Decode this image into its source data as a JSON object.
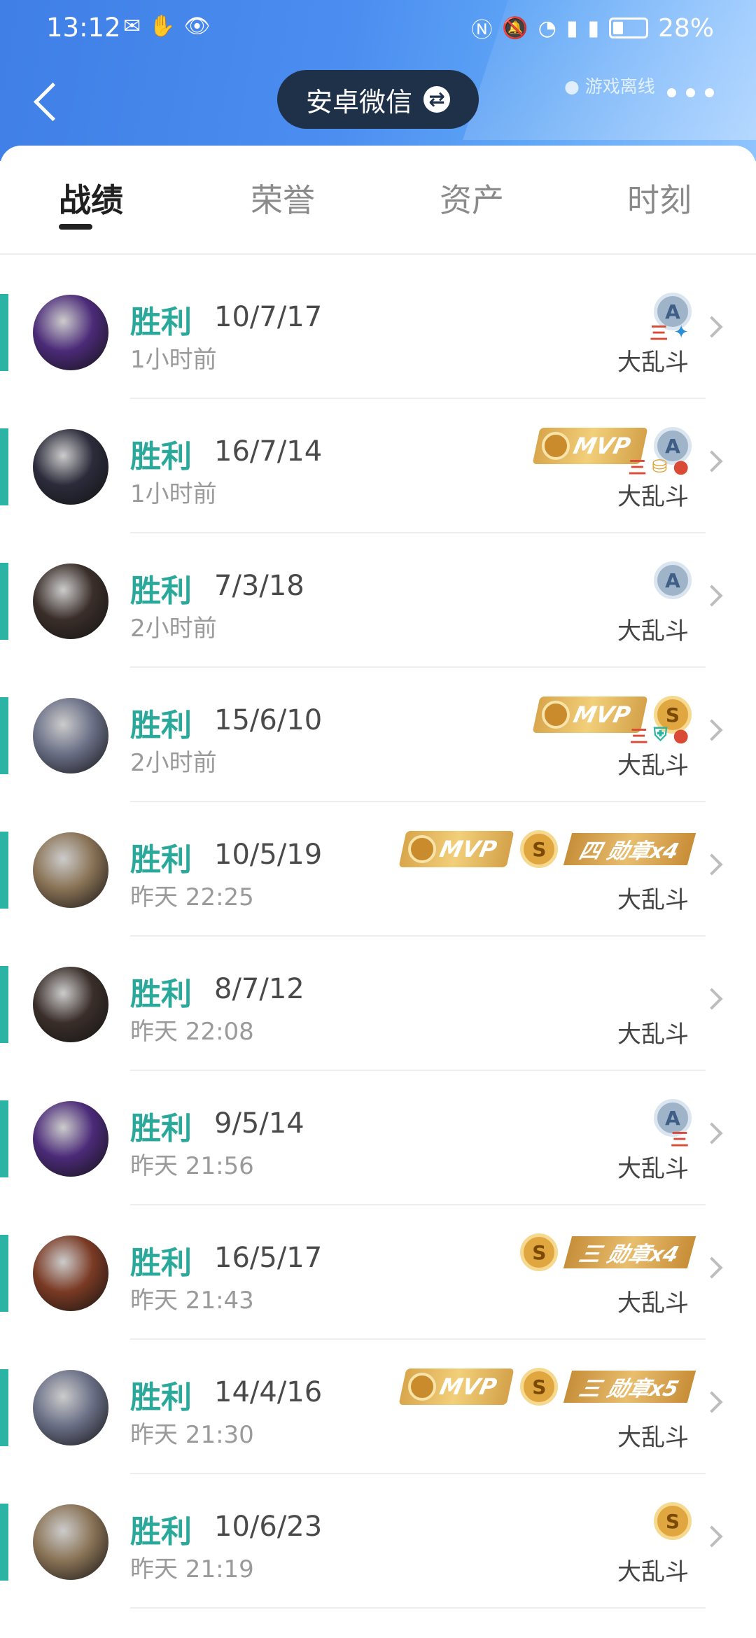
{
  "status_bar": {
    "time": "13:12",
    "battery": "28%",
    "left_icons": [
      "wechat-icon",
      "hand-icon",
      "eye-icon"
    ],
    "right_icons": [
      "nfc-icon",
      "mute-icon",
      "wifi-icon",
      "4g-signal-icon",
      "4g-signal-icon",
      "battery-icon"
    ]
  },
  "header": {
    "account_label": "安卓微信",
    "offline_status": "游戏离线"
  },
  "tabs": [
    {
      "label": "战绩",
      "active": true
    },
    {
      "label": "荣誉",
      "active": false
    },
    {
      "label": "资产",
      "active": false
    },
    {
      "label": "时刻",
      "active": false
    }
  ],
  "matches": [
    {
      "result": "胜利",
      "kda": "10/7/17",
      "time": "1小时前",
      "mode": "大乱斗",
      "mvp": false,
      "medal": "A",
      "ribbon": "",
      "icons": [
        "三",
        "bird"
      ]
    },
    {
      "result": "胜利",
      "kda": "16/7/14",
      "time": "1小时前",
      "mode": "大乱斗",
      "mvp": true,
      "mvp_label": "MVP",
      "medal": "A",
      "ribbon": "",
      "icons": [
        "三",
        "coins",
        "blood"
      ]
    },
    {
      "result": "胜利",
      "kda": "7/3/18",
      "time": "2小时前",
      "mode": "大乱斗",
      "mvp": false,
      "medal": "A",
      "ribbon": "",
      "icons": []
    },
    {
      "result": "胜利",
      "kda": "15/6/10",
      "time": "2小时前",
      "mode": "大乱斗",
      "mvp": true,
      "mvp_label": "MVP",
      "medal": "S",
      "ribbon": "",
      "icons": [
        "三",
        "shield",
        "blood"
      ]
    },
    {
      "result": "胜利",
      "kda": "10/5/19",
      "time": "昨天 22:25",
      "mode": "大乱斗",
      "mvp": true,
      "mvp_label": "MVP",
      "medal": "S",
      "ribbon": "四 勋章x4",
      "icons": []
    },
    {
      "result": "胜利",
      "kda": "8/7/12",
      "time": "昨天 22:08",
      "mode": "大乱斗",
      "mvp": false,
      "medal": "",
      "ribbon": "",
      "icons": []
    },
    {
      "result": "胜利",
      "kda": "9/5/14",
      "time": "昨天 21:56",
      "mode": "大乱斗",
      "mvp": false,
      "medal": "A",
      "ribbon": "",
      "icons": [
        "三"
      ]
    },
    {
      "result": "胜利",
      "kda": "16/5/17",
      "time": "昨天 21:43",
      "mode": "大乱斗",
      "mvp": false,
      "medal": "S",
      "ribbon": "三 勋章x4",
      "icons": []
    },
    {
      "result": "胜利",
      "kda": "14/4/16",
      "time": "昨天 21:30",
      "mode": "大乱斗",
      "mvp": true,
      "mvp_label": "MVP",
      "medal": "S",
      "ribbon": "三 勋章x5",
      "icons": []
    },
    {
      "result": "胜利",
      "kda": "10/6/23",
      "time": "昨天 21:19",
      "mode": "大乱斗",
      "mvp": false,
      "medal": "S",
      "ribbon": "",
      "icons": []
    }
  ],
  "avatar_colors": [
    "#4b2a78",
    "#2b2b3b",
    "#3a2e2a",
    "#6a6f86",
    "#8a7356",
    "#3a2e2a",
    "#4b2a78",
    "#7a3a24",
    "#6a6f86",
    "#8a7356"
  ]
}
